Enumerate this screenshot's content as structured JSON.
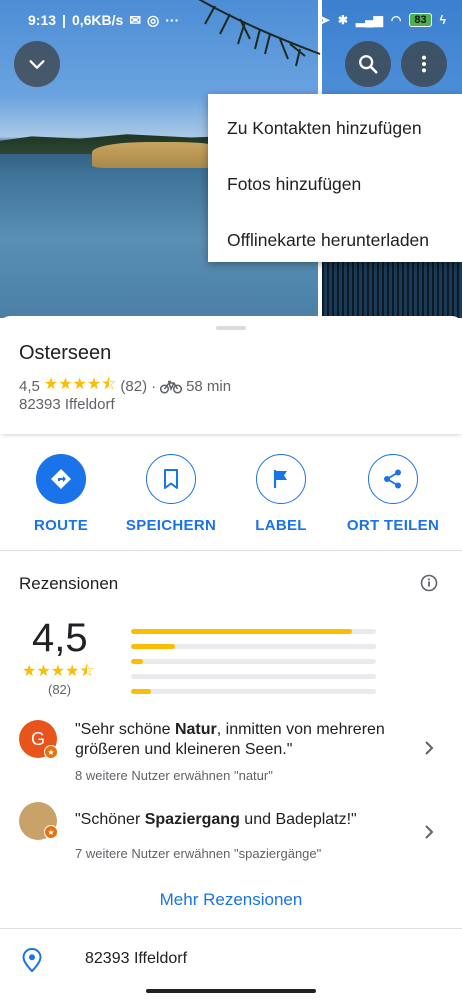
{
  "status_bar": {
    "time": "9:13",
    "network_speed": "0,6KB/s",
    "battery": "83"
  },
  "icons": {
    "collapse": "chevron-down-icon",
    "search": "search-icon",
    "more": "more-vert-icon"
  },
  "menu": {
    "items": [
      {
        "label": "Zu Kontakten hinzufügen"
      },
      {
        "label": "Fotos hinzufügen"
      },
      {
        "label": "Offlinekarte herunterladen"
      }
    ]
  },
  "place": {
    "title": "Osterseen",
    "rating": "4,5",
    "stars": "★★★★⯪",
    "review_count": "(82)",
    "travel_separator": "·",
    "travel_mode_icon": "bike-icon",
    "travel_time": "58 min",
    "address": "82393 Iffeldorf"
  },
  "actions": [
    {
      "label": "ROUTE",
      "icon": "directions-icon"
    },
    {
      "label": "SPEICHERN",
      "icon": "bookmark-icon"
    },
    {
      "label": "LABEL",
      "icon": "flag-icon"
    },
    {
      "label": "ORT TEILEN",
      "icon": "share-icon"
    }
  ],
  "reviews": {
    "title": "Rezensionen",
    "summary_rating": "4,5",
    "summary_stars": "★★★★⯪",
    "summary_count": "(82)",
    "distribution": [
      0.9,
      0.18,
      0.05,
      0.0,
      0.08
    ],
    "items": [
      {
        "avatar_letter": "G",
        "avatar_color": "#e8541c",
        "text_before": "\"Sehr schöne ",
        "text_bold": "Natur",
        "text_after": ", inmitten von mehreren größeren und kleineren Seen.\"",
        "meta": "8 weitere Nutzer erwähnen \"natur\""
      },
      {
        "avatar_letter": "",
        "avatar_color": "#c9a26a",
        "text_before": "\"Schöner ",
        "text_bold": "Spaziergang",
        "text_after": " und Badeplatz!\"",
        "meta": "7 weitere Nutzer erwähnen \"spaziergänge\""
      }
    ],
    "more_label": "Mehr Rezensionen"
  },
  "address_row": {
    "text": "82393 Iffeldorf"
  },
  "colors": {
    "accent": "#1a73e8",
    "star": "#fbbc04"
  }
}
